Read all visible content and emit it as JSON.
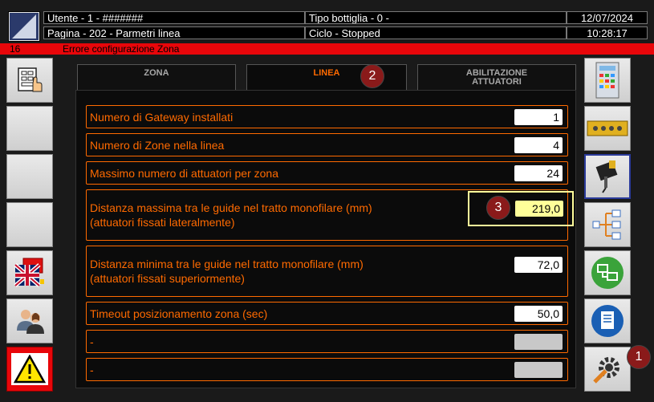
{
  "header": {
    "user": "Utente - 1 - #######",
    "page": "Pagina - 202 - Parmetri linea",
    "bottle_type": "Tipo bottiglia - 0 -",
    "cycle": "Ciclo - Stopped",
    "date": "12/07/2024",
    "time": "10:28:17"
  },
  "alarm": {
    "code": "16",
    "message": "Errore configurazione Zona",
    "color": "#e8060a"
  },
  "tabs": [
    {
      "label": "ZONA",
      "active": false
    },
    {
      "label": "LINEA",
      "active": true
    },
    {
      "label": "ABILITAZIONE ATTUATORI",
      "active": false
    }
  ],
  "params": [
    {
      "label": "Numero di Gateway installati",
      "value": "1"
    },
    {
      "label": "Numero di Zone nella linea",
      "value": "4"
    },
    {
      "label": "Massimo numero di attuatori per zona",
      "value": "24"
    },
    {
      "label": "Distanza massima tra le guide nel tratto monofilare (mm)",
      "label2": "(attuatori fissati lateralmente)",
      "value": "219,0"
    },
    {
      "label": "Distanza minima tra le guide nel tratto monofilare (mm)",
      "label2": "(attuatori fissati superiormente)",
      "value": "72,0"
    },
    {
      "label": "Timeout posizionamento zona (sec)",
      "value": "50,0"
    },
    {
      "label": "-",
      "value": ""
    },
    {
      "label": "-",
      "value": ""
    }
  ],
  "badges": {
    "b1": "1",
    "b2": "2",
    "b3": "3"
  },
  "colors": {
    "accent": "#ff6a00",
    "highlight": "#ffff99",
    "alarm": "#e8060a"
  },
  "left_buttons": [
    "keypad-hand-icon",
    "blank",
    "blank",
    "blank",
    "uk-flag-icon",
    "users-icon",
    "warning-icon"
  ],
  "right_buttons": [
    "control-panel-icon",
    "gateway-module-icon",
    "actuator-icon",
    "network-tree-icon",
    "monitors-icon",
    "document-icon",
    "settings-gear-icon"
  ]
}
